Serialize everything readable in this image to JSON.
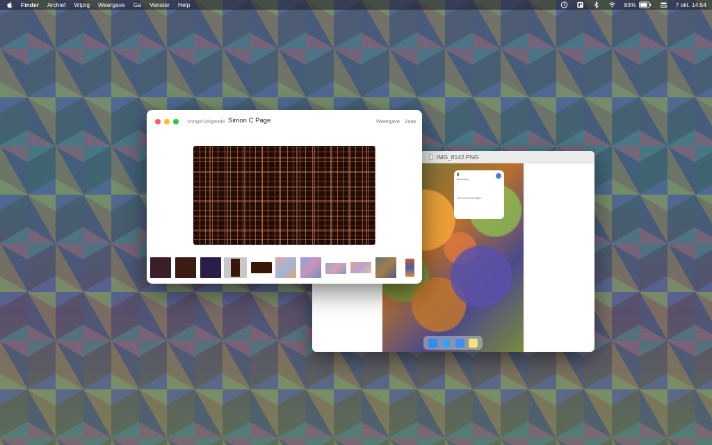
{
  "menubar": {
    "app_name": "Finder",
    "items": [
      "Archief",
      "Wijzig",
      "Weergave",
      "Ga",
      "Venster",
      "Help"
    ],
    "battery": "83%",
    "datetime": "7 okt. 14:54"
  },
  "background_window": {
    "title": "IMG_8142.PNG",
    "widget_number": "0",
    "widget_caption": "Maandag",
    "widget_note": "Geen herinneringen"
  },
  "quicklook": {
    "nav_label": "Vorige/Volgende",
    "title": "Simon C Page",
    "view_label": "Weergave",
    "search_label": "Zoek"
  },
  "colors": {
    "close": "#fe5f57",
    "minimize": "#febc2e",
    "zoom": "#28c840"
  },
  "icons": {
    "apple": "apple-icon",
    "clock": "clock-icon",
    "window_layout": "window-layout-icon",
    "bluetooth": "bluetooth-icon",
    "wifi": "wifi-icon",
    "battery": "battery-icon",
    "control_center": "control-center-icon"
  }
}
